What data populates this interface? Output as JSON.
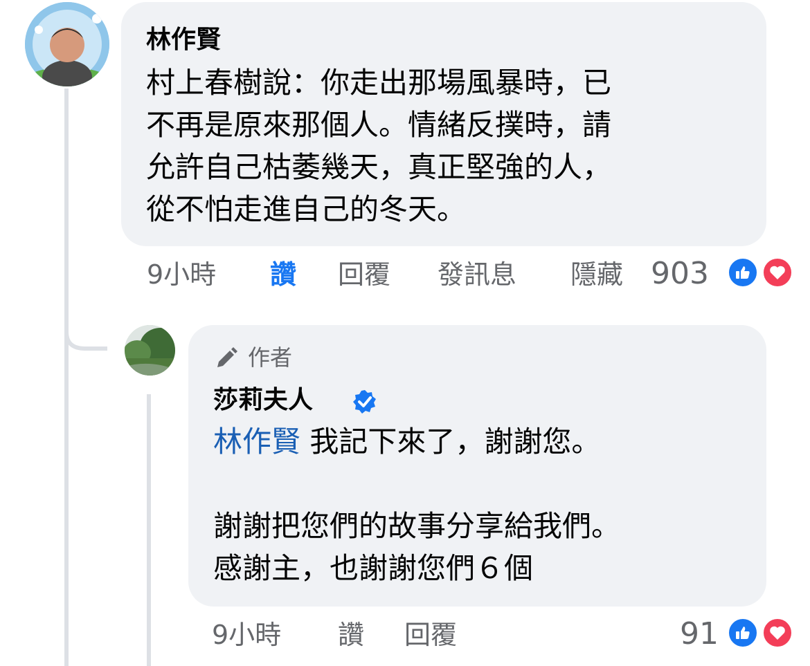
{
  "comment1": {
    "author": "林作賢",
    "text_lines": [
      "村上春樹說：你走出那場風暴時，已",
      "不再是原來那個人。情緒反撲時，請",
      "允許自己枯萎幾天，真正堅強的人，",
      "從不怕走進自己的冬天。"
    ],
    "actions": {
      "time": "9小時",
      "like": "讚",
      "reply": "回覆",
      "message": "發訊息",
      "hide": "隱藏"
    },
    "reaction_count": "903"
  },
  "reply1": {
    "badge": "作者",
    "author": "莎莉夫人",
    "mention": "林作賢",
    "line1": " 我記下來了，謝謝您。",
    "line2": "謝謝把您們的故事分享給我們。",
    "line3": "感謝主，也謝謝您們６個",
    "actions": {
      "time": "9小時",
      "like": "讚",
      "reply": "回覆"
    },
    "reaction_count": "91"
  },
  "colors": {
    "accent": "#1877f2",
    "bubble": "#f0f2f5",
    "muted": "#65676b",
    "love": "#f33e58",
    "mention": "#1a5fb4"
  },
  "icons": [
    "like-reaction-icon",
    "love-reaction-icon",
    "pen-icon",
    "verified-badge-icon"
  ]
}
